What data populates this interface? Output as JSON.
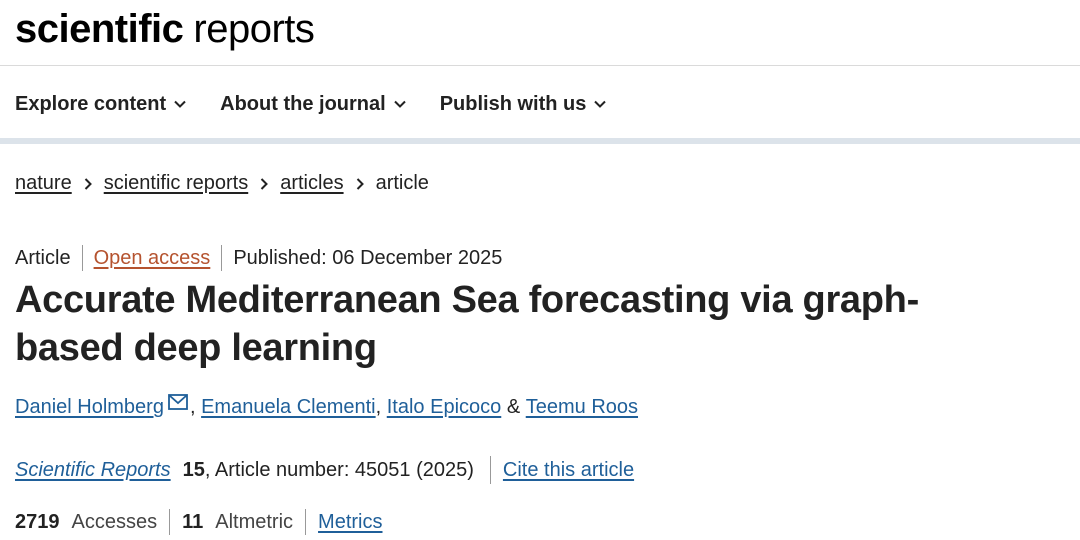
{
  "brand": {
    "bold": "scientific",
    "light": "reports"
  },
  "nav": [
    {
      "label": "Explore content"
    },
    {
      "label": "About the journal"
    },
    {
      "label": "Publish with us"
    }
  ],
  "breadcrumb": [
    "nature",
    "scientific reports",
    "articles",
    "article"
  ],
  "article": {
    "type": "Article",
    "access": "Open access",
    "published": "Published: 06 December 2025",
    "title": "Accurate Mediterranean Sea forecasting via graph-based deep learning",
    "authors": [
      "Daniel Holmberg",
      "Emanuela Clementi",
      "Italo Epicoco",
      "Teemu Roos"
    ],
    "author_sep_comma": ",",
    "author_sep_and": "&",
    "journal": "Scientific Reports",
    "volume": "15",
    "article_number": ", Article number: 45051 (2025)",
    "cite_label": "Cite this article",
    "accesses": "2719",
    "accesses_label": "Accesses",
    "altmetric": "11",
    "altmetric_label": "Altmetric",
    "metrics_label": "Metrics"
  },
  "icons": {
    "chevron": "chevron-down-icon",
    "breadcrumb_sep": "chevron-right-icon",
    "mail": "mail-icon"
  },
  "colors": {
    "link": "#1f5f99",
    "open_access": "#b5532f",
    "nav_bar": "#dce3ea"
  }
}
